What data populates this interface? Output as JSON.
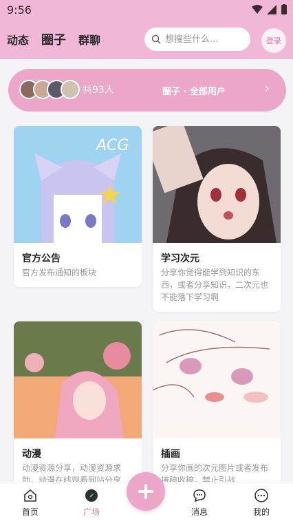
{
  "status_bar": {
    "time": "9:56"
  },
  "header": {
    "tabs": [
      {
        "label": "动态"
      },
      {
        "label": "圈子"
      },
      {
        "label": "群聊"
      }
    ],
    "search_placeholder": "想搜些什么...",
    "login_label": "登录"
  },
  "banner": {
    "count_text": "共93人",
    "title": "圈子 · 全部用户"
  },
  "cards": [
    {
      "name": "官方公告",
      "desc": "官方发布通知的板块",
      "image_text": "ACG"
    },
    {
      "name": "学习次元",
      "desc": "分享你觉得能学到知识的东西，或者分享知识，二次元也不能落下学习啊"
    },
    {
      "name": "动漫",
      "desc": "动漫资源分享，动漫资源求助，动漫在线观看网站分享"
    },
    {
      "name": "插画",
      "desc": "分享你画的次元图片或者发布接稿收稿，禁止引战"
    }
  ],
  "nav": {
    "items": [
      {
        "label": "首页"
      },
      {
        "label": "广场"
      },
      {
        "label": "消息"
      },
      {
        "label": "我的"
      }
    ]
  },
  "colors": {
    "accent": "#eca6c8",
    "header": "#f0b8d6",
    "active": "#e67ab0"
  }
}
